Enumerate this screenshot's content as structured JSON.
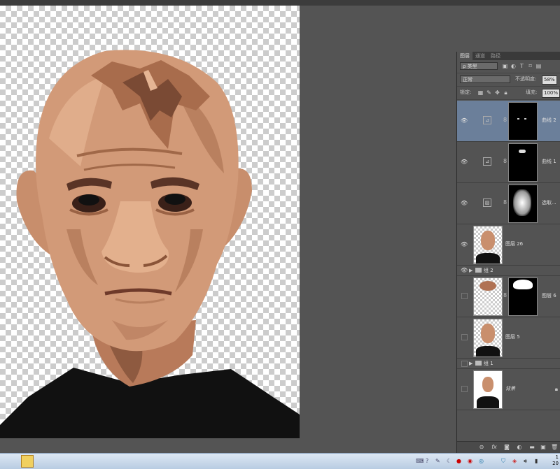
{
  "panel": {
    "tabs": [
      "图层",
      "通道",
      "路径"
    ],
    "filter_kind": "ρ 类型",
    "blend_mode": "正常",
    "opacity_label": "不透明度:",
    "opacity_value": "58%",
    "lock_label": "锁定:",
    "fill_label": "填充:",
    "fill_value": "100%"
  },
  "layers": [
    {
      "name": "曲线 2",
      "visible": true,
      "selected": true,
      "type": "adjustment"
    },
    {
      "name": "曲线 1",
      "visible": true,
      "selected": false,
      "type": "adjustment"
    },
    {
      "name": "选取...",
      "visible": true,
      "selected": false,
      "type": "adjustment"
    },
    {
      "name": "图层 26",
      "visible": true,
      "selected": false,
      "type": "pixel"
    },
    {
      "name": "组 2",
      "visible": true,
      "selected": false,
      "type": "group"
    },
    {
      "name": "图层 6",
      "visible": false,
      "selected": false,
      "type": "pixel-mask"
    },
    {
      "name": "图层 5",
      "visible": false,
      "selected": false,
      "type": "pixel"
    },
    {
      "name": "组 1",
      "visible": false,
      "selected": false,
      "type": "group"
    },
    {
      "name": "背景",
      "visible": false,
      "selected": false,
      "type": "background",
      "locked": true
    }
  ],
  "panel_footer_icons": [
    "link-icon",
    "fx-icon",
    "add-mask-icon",
    "adjustment-icon",
    "folder-icon",
    "new-layer-icon",
    "trash-icon"
  ],
  "taskbar": {
    "clock_line1": "1",
    "clock_line2": "20"
  },
  "colors": {
    "selected_layer": "#6b7f9a",
    "panel_bg": "#535353",
    "workspace_bg": "#545454"
  }
}
